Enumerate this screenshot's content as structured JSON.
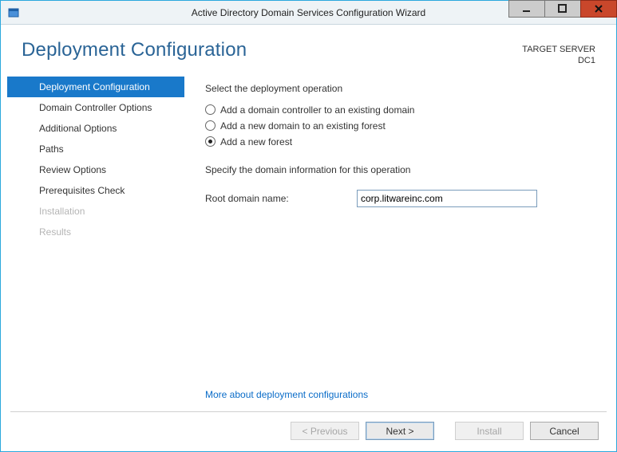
{
  "window": {
    "title": "Active Directory Domain Services Configuration Wizard"
  },
  "header": {
    "page_title": "Deployment Configuration",
    "target_label": "TARGET SERVER",
    "target_value": "DC1"
  },
  "sidebar": {
    "items": [
      {
        "label": "Deployment Configuration",
        "state": "active"
      },
      {
        "label": "Domain Controller Options",
        "state": "normal"
      },
      {
        "label": "Additional Options",
        "state": "normal"
      },
      {
        "label": "Paths",
        "state": "normal"
      },
      {
        "label": "Review Options",
        "state": "normal"
      },
      {
        "label": "Prerequisites Check",
        "state": "normal"
      },
      {
        "label": "Installation",
        "state": "disabled"
      },
      {
        "label": "Results",
        "state": "disabled"
      }
    ]
  },
  "content": {
    "operation_label": "Select the deployment operation",
    "radios": [
      {
        "label": "Add a domain controller to an existing domain",
        "checked": false
      },
      {
        "label": "Add a new domain to an existing forest",
        "checked": false
      },
      {
        "label": "Add a new forest",
        "checked": true
      }
    ],
    "info_label": "Specify the domain information for this operation",
    "root_domain_label": "Root domain name:",
    "root_domain_value": "corp.litwareinc.com",
    "help_link": "More about deployment configurations"
  },
  "footer": {
    "previous": "< Previous",
    "next": "Next >",
    "install": "Install",
    "cancel": "Cancel"
  }
}
